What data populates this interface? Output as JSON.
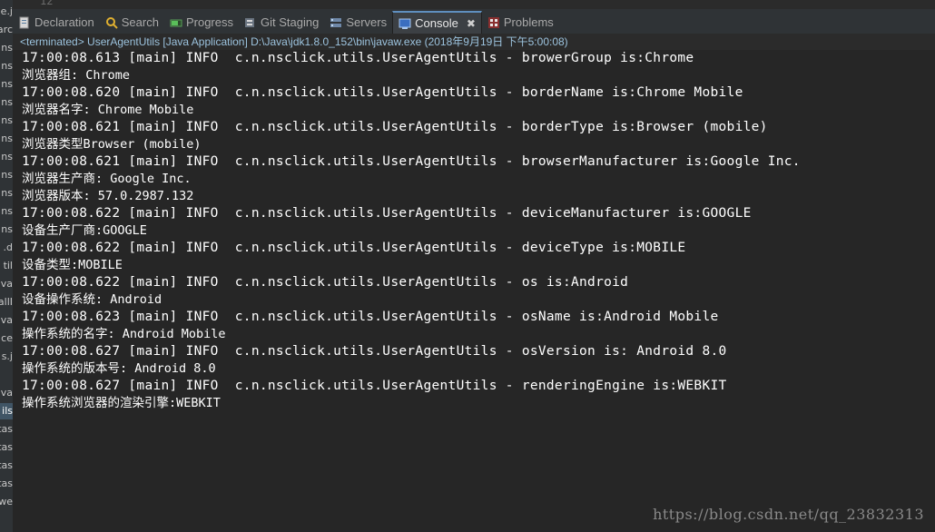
{
  "left_strip": {
    "fragments": [
      "e.j",
      "arc",
      "ns",
      "ns",
      "ns",
      "ns",
      "ns",
      "ns",
      "ns",
      "ns",
      "ns",
      "ns",
      "ns",
      "d.",
      "til",
      "va",
      "allI",
      "va",
      "ce",
      "s.j",
      "",
      "va",
      "ils",
      "tas",
      "tas",
      "tas",
      "tas",
      "we",
      ""
    ]
  },
  "editor": {
    "line_number": "12"
  },
  "tabs": [
    {
      "label": "Declaration",
      "icon": "declaration-icon"
    },
    {
      "label": "Search",
      "icon": "search-icon"
    },
    {
      "label": "Progress",
      "icon": "progress-icon"
    },
    {
      "label": "Git Staging",
      "icon": "git-icon"
    },
    {
      "label": "Servers",
      "icon": "servers-icon"
    },
    {
      "label": "Console",
      "icon": "console-icon",
      "active": true
    },
    {
      "label": "Problems",
      "icon": "problems-icon"
    }
  ],
  "console_close_glyph": "✖",
  "info_bar": "<terminated> UserAgentUtils [Java Application] D:\\Java\\jdk1.8.0_152\\bin\\javaw.exe (2018年9月19日 下午5:00:08)",
  "console_lines": [
    {
      "type": "log",
      "text": "17:00:08.613 [main] INFO  c.n.nsclick.utils.UserAgentUtils - browerGroup is:Chrome"
    },
    {
      "type": "cn",
      "text": "浏览器组: Chrome"
    },
    {
      "type": "log",
      "text": "17:00:08.620 [main] INFO  c.n.nsclick.utils.UserAgentUtils - borderName is:Chrome Mobile"
    },
    {
      "type": "cn",
      "text": "浏览器名字: Chrome Mobile"
    },
    {
      "type": "log",
      "text": "17:00:08.621 [main] INFO  c.n.nsclick.utils.UserAgentUtils - borderType is:Browser (mobile)"
    },
    {
      "type": "cn",
      "text": "浏览器类型Browser (mobile)"
    },
    {
      "type": "log",
      "text": "17:00:08.621 [main] INFO  c.n.nsclick.utils.UserAgentUtils - browserManufacturer is:Google Inc."
    },
    {
      "type": "cn",
      "text": "浏览器生产商: Google Inc."
    },
    {
      "type": "cn",
      "text": "浏览器版本: 57.0.2987.132"
    },
    {
      "type": "log",
      "text": "17:00:08.622 [main] INFO  c.n.nsclick.utils.UserAgentUtils - deviceManufacturer is:GOOGLE"
    },
    {
      "type": "cn",
      "text": "设备生产厂商:GOOGLE"
    },
    {
      "type": "log",
      "text": "17:00:08.622 [main] INFO  c.n.nsclick.utils.UserAgentUtils - deviceType is:MOBILE"
    },
    {
      "type": "cn",
      "text": "设备类型:MOBILE"
    },
    {
      "type": "log",
      "text": "17:00:08.622 [main] INFO  c.n.nsclick.utils.UserAgentUtils - os is:Android"
    },
    {
      "type": "cn",
      "text": "设备操作系统: Android"
    },
    {
      "type": "log",
      "text": "17:00:08.623 [main] INFO  c.n.nsclick.utils.UserAgentUtils - osName is:Android Mobile"
    },
    {
      "type": "cn",
      "text": "操作系统的名字: Android Mobile"
    },
    {
      "type": "log",
      "text": "17:00:08.627 [main] INFO  c.n.nsclick.utils.UserAgentUtils - osVersion is: Android 8.0"
    },
    {
      "type": "cn",
      "text": "操作系统的版本号: Android 8.0"
    },
    {
      "type": "log",
      "text": "17:00:08.627 [main] INFO  c.n.nsclick.utils.UserAgentUtils - renderingEngine is:WEBKIT"
    },
    {
      "type": "cn",
      "text": "操作系统浏览器的渲染引擎:WEBKIT"
    }
  ],
  "watermark": "https://blog.csdn.net/qq_23832313",
  "colors": {
    "background": "#262626",
    "console_text": "#ffffff",
    "info_text": "#9cc3de",
    "active_tab_accent": "#5f8fbf"
  }
}
